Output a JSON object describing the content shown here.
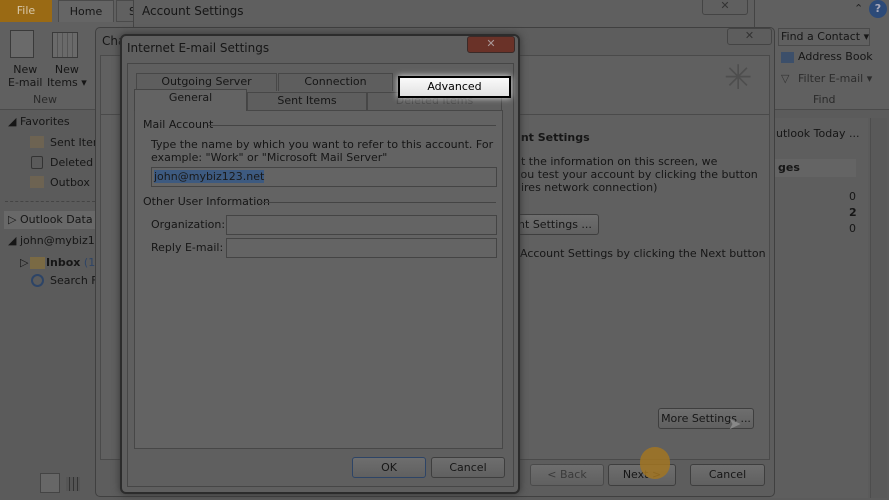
{
  "ribbon": {
    "tabs": [
      "File",
      "Home",
      "S"
    ],
    "new_email": "New\nE-mail",
    "new_items": "New\nItems ▾",
    "group_new": "New",
    "find_contact": "Find a Contact ▾",
    "address_book": "Address Book",
    "filter_email": "Filter E-mail ▾",
    "group_find": "Find"
  },
  "nav": {
    "favorites": "Favorites",
    "fav_items": [
      "Sent Iter",
      "Deleted",
      "Outbox"
    ],
    "data_file": "Outlook Data",
    "account": "john@mybiz1",
    "inbox": "Inbox",
    "inbox_count": "(1",
    "search": "Search F"
  },
  "right_panel": {
    "outlook_today": "utlook Today ...",
    "messages": "ges",
    "counts": [
      "0",
      "2",
      "0"
    ]
  },
  "account_settings": {
    "title": "Account Settings"
  },
  "change_account": {
    "title": "Cha",
    "heading": "unt Settings",
    "desc": [
      "ut the information on this screen, we",
      "you test your account by clicking the button",
      "uires network connection)"
    ],
    "test_button": "unt Settings ...",
    "next_hint": "Account Settings by clicking the Next button",
    "more_settings": "More Settings ...",
    "back": "< Back",
    "next": "Next >",
    "cancel": "Cancel"
  },
  "dialog": {
    "title": "Internet E-mail Settings",
    "close": "✕",
    "tabs_row1": [
      "Outgoing Server",
      "Connection",
      "Advanced"
    ],
    "tabs_row2": [
      "General",
      "Sent Items",
      "Deleted Items"
    ],
    "mail_account": "Mail Account",
    "mail_desc": "Type the name by which you want to refer to this account. For\nexample: \"Work\" or \"Microsoft Mail Server\"",
    "account_name": "john@mybiz123.net",
    "other_info": "Other User Information",
    "org_label": "Organization:",
    "org_value": "",
    "reply_label": "Reply E-mail:",
    "reply_value": "",
    "ok": "OK",
    "cancel": "Cancel"
  },
  "colors": {
    "highlight": "#ffffff",
    "file_tab": "#9a6a14",
    "selection": "#3d5a80"
  }
}
